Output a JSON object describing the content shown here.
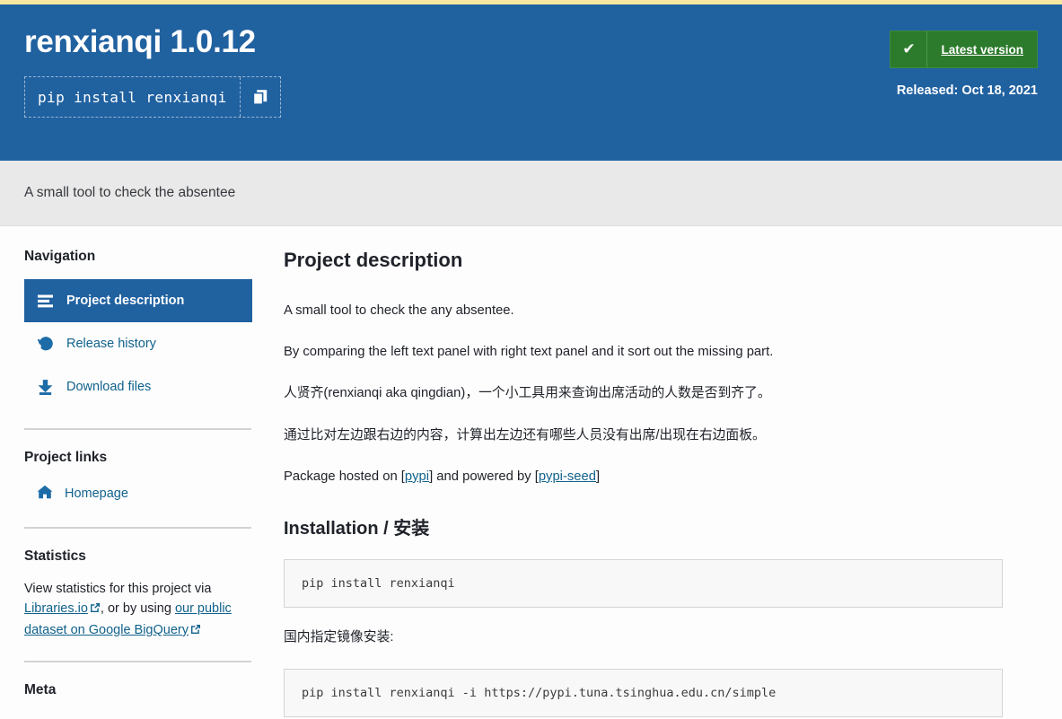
{
  "colors": {
    "banner_blue": "#2061a0",
    "top_strip_gold": "#f6e6a0",
    "badge_green": "#2c7a2c",
    "link_blue": "#11628c",
    "subtitle_bg": "#e9e9e9"
  },
  "banner": {
    "title": "renxianqi 1.0.12",
    "pip_command": "pip install renxianqi",
    "copy_icon": "copy-icon",
    "badge": {
      "check_icon": "check-icon",
      "label": "Latest version"
    },
    "released": "Released: Oct 18, 2021"
  },
  "subtitle": {
    "text": "A small tool to check the absentee"
  },
  "sidebar": {
    "navigation_heading": "Navigation",
    "nav_items": [
      {
        "label": "Project description",
        "icon": "align-left-icon",
        "active": true
      },
      {
        "label": "Release history",
        "icon": "history-icon",
        "active": false
      },
      {
        "label": "Download files",
        "icon": "download-icon",
        "active": false
      }
    ],
    "project_links_heading": "Project links",
    "project_links": [
      {
        "label": "Homepage",
        "icon": "home-icon"
      }
    ],
    "statistics_heading": "Statistics",
    "statistics": {
      "lead": "View statistics for this project via ",
      "link1": "Libraries.io",
      "mid": ", or by using ",
      "link2": "our public dataset on Google BigQuery",
      "external_icon": "external-link-icon"
    },
    "meta_heading": "Meta"
  },
  "main": {
    "heading": "Project description",
    "paragraphs": [
      "A small tool to check the any absentee.",
      "By comparing the left text panel with right text panel and it sort out the missing part.",
      "人贤齐(renxianqi aka qingdian)，一个小工具用来查询出席活动的人数是否到齐了。",
      "通过比对左边跟右边的内容，计算出左边还有哪些人员没有出席/出现在右边面板。"
    ],
    "package_line": {
      "prefix": "Package hosted on [",
      "link1": "pypi",
      "mid": "] and powered by [",
      "link2": "pypi-seed",
      "suffix": "]"
    },
    "installation_heading": "Installation / 安装",
    "code1": "pip install renxianqi",
    "mirror_note": "国内指定镜像安装:",
    "code2": "pip install renxianqi -i https://pypi.tuna.tsinghua.edu.cn/simple"
  }
}
